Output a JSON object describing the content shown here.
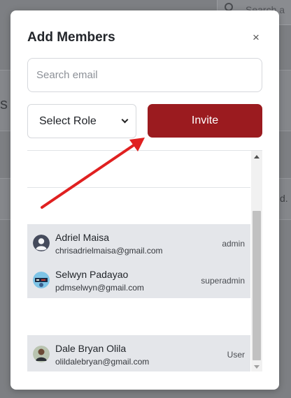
{
  "background": {
    "search_placeholder": "Search a",
    "left_fragment": "s",
    "right_fragment": "d."
  },
  "modal": {
    "title": "Add Members",
    "close_label": "×",
    "search": {
      "placeholder": "Search email",
      "value": ""
    },
    "role_select": {
      "selected": "Select Role"
    },
    "invite_label": "Invite"
  },
  "members": [
    {
      "name": "Adriel Maisa",
      "email": "chrisadrielmaisa@gmail.com",
      "role": "admin",
      "avatar": "default-user-avatar"
    },
    {
      "name": "Selwyn Padayao",
      "email": "pdmselwyn@gmail.com",
      "role": "superadmin",
      "avatar": "photo-avatar"
    },
    {
      "name": "Dale Bryan Olila",
      "email": "olildalebryan@gmail.com",
      "role": "User",
      "avatar": "photo-avatar"
    }
  ],
  "colors": {
    "invite_button": "#9b1b1f",
    "selected_row": "#e4e6ea",
    "annotation_arrow": "#e02020"
  },
  "icons": {
    "close": "close-icon",
    "select": "chevron-down-icon",
    "annotation": "arrow-icon"
  }
}
